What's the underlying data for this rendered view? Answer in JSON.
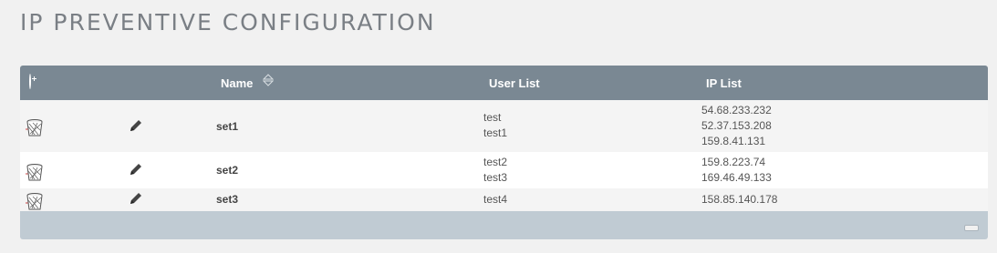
{
  "page": {
    "title": "IP PREVENTIVE CONFIGURATION"
  },
  "table": {
    "columns": {
      "name": "Name",
      "user_list": "User List",
      "ip_list": "IP List"
    },
    "rows": [
      {
        "name": "set1",
        "users": [
          "test",
          "test1"
        ],
        "ips": [
          "54.68.233.232",
          "52.37.153.208",
          "159.8.41.131"
        ]
      },
      {
        "name": "set2",
        "users": [
          "test2",
          "test3"
        ],
        "ips": [
          "159.8.223.74",
          "169.46.49.133"
        ]
      },
      {
        "name": "set3",
        "users": [
          "test4"
        ],
        "ips": [
          "158.85.140.178"
        ]
      }
    ]
  },
  "icons": {
    "add": "add-circle-icon",
    "sort": "sort-icon",
    "delete": "trash-icon",
    "edit": "pencil-icon"
  },
  "colors": {
    "header_bg": "#7a8893",
    "footer_bg": "#c0cbd3",
    "title": "#7a7f85"
  }
}
